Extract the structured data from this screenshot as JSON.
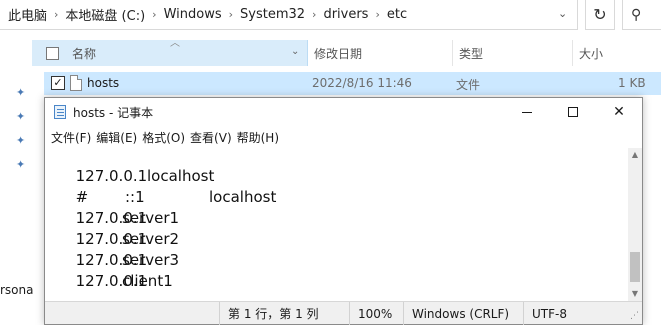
{
  "explorer": {
    "breadcrumb": [
      "此电脑",
      "本地磁盘 (C:)",
      "Windows",
      "System32",
      "drivers",
      "etc"
    ],
    "columns": {
      "name": "名称",
      "date": "修改日期",
      "type": "类型",
      "size": "大小"
    },
    "file": {
      "name": "hosts",
      "date": "2022/8/16 11:46",
      "type": "文件",
      "size": "1 KB"
    },
    "sidebar_fragment": "rsona"
  },
  "notepad": {
    "title": "hosts - 记事本",
    "menu": [
      "文件(F)",
      "编辑(E)",
      "格式(O)",
      "查看(V)",
      "帮助(H)"
    ],
    "lines": [
      [
        "127.0.0.1",
        "localhost"
      ],
      [
        "#",
        "::1",
        "localhost"
      ],
      [
        "127.0.0.1",
        "server1"
      ],
      [
        "127.0.0.1",
        "server2"
      ],
      [
        "127.0.0.1",
        "server3"
      ],
      [
        "127.0.0.1",
        "client1"
      ]
    ],
    "status": {
      "position": "第 1 行，第 1 列",
      "zoom": "100%",
      "line_ending": "Windows (CRLF)",
      "encoding": "UTF-8"
    }
  },
  "icons": {
    "pin": "pin-icon",
    "file": "file-icon",
    "notepad": "notepad-app-icon",
    "refresh": "refresh-icon",
    "search": "search-icon"
  }
}
